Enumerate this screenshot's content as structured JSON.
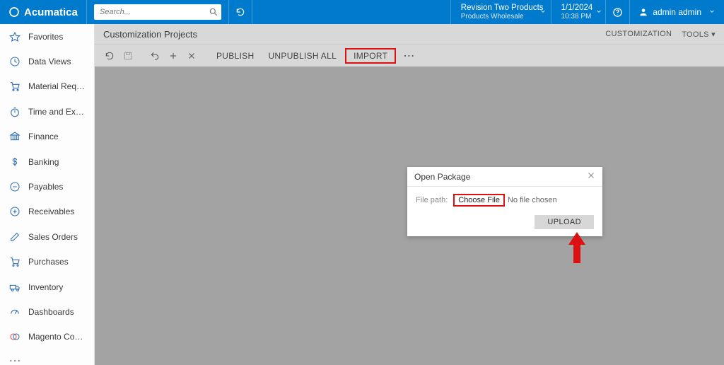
{
  "header": {
    "brand": "Acumatica",
    "search_placeholder": "Search...",
    "tenant_line1": "Revision Two Products",
    "tenant_line2": "Products Wholesale",
    "date": "1/1/2024",
    "time": "10:38 PM",
    "user_name": "admin admin"
  },
  "sidebar": {
    "items": [
      {
        "icon": "star-icon",
        "label": "Favorites"
      },
      {
        "icon": "clock-data-icon",
        "label": "Data Views"
      },
      {
        "icon": "cart-icon",
        "label": "Material Requirements Planning"
      },
      {
        "icon": "stopwatch-icon",
        "label": "Time and Expenses"
      },
      {
        "icon": "bank-icon",
        "label": "Finance"
      },
      {
        "icon": "dollar-icon",
        "label": "Banking"
      },
      {
        "icon": "minus-circle-icon",
        "label": "Payables"
      },
      {
        "icon": "plus-circle-icon",
        "label": "Receivables"
      },
      {
        "icon": "edit-icon",
        "label": "Sales Orders"
      },
      {
        "icon": "cart2-icon",
        "label": "Purchases"
      },
      {
        "icon": "truck-icon",
        "label": "Inventory"
      },
      {
        "icon": "gauge-icon",
        "label": "Dashboards"
      },
      {
        "icon": "magento-icon",
        "label": "Magento Connector"
      }
    ]
  },
  "page": {
    "title": "Customization Projects",
    "top_links": {
      "customization": "CUSTOMIZATION",
      "tools": "TOOLS"
    }
  },
  "toolbar": {
    "publish": "PUBLISH",
    "unpublish_all": "UNPUBLISH ALL",
    "import": "IMPORT"
  },
  "dialog": {
    "title": "Open Package",
    "file_path_label": "File path:",
    "choose_file": "Choose File",
    "no_file": "No file chosen",
    "upload": "UPLOAD"
  }
}
